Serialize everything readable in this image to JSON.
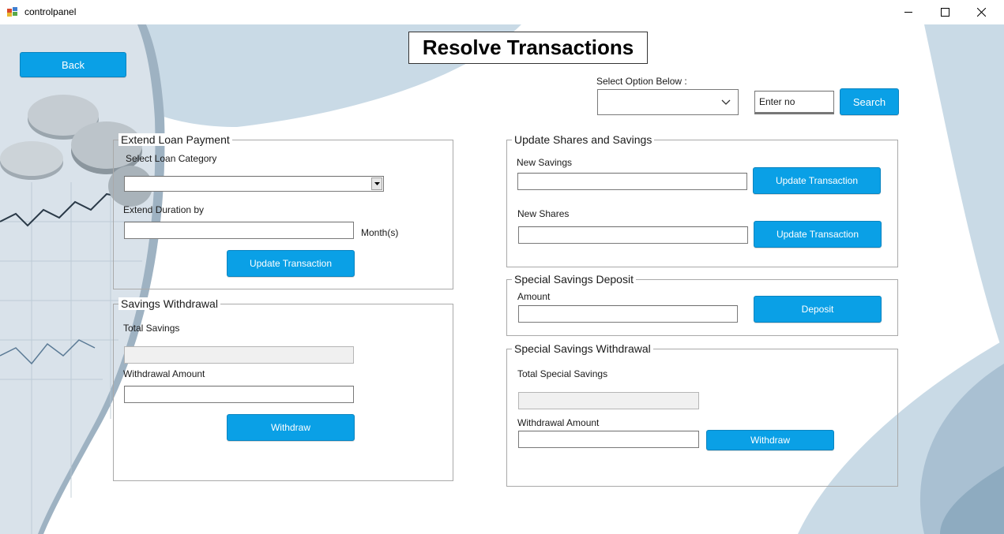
{
  "window": {
    "title": "controlpanel",
    "minimize_icon": "minimize-icon",
    "maximize_icon": "maximize-icon",
    "close_icon": "close-icon"
  },
  "page": {
    "heading": "Resolve Transactions",
    "back_label": "Back"
  },
  "search": {
    "option_label": "Select  Option Below :",
    "option_value": "",
    "input_value": "Enter  no",
    "button_label": "Search"
  },
  "extend_loan": {
    "legend": "Extend Loan Payment",
    "category_label": "Select Loan Category",
    "category_value": "",
    "duration_label": "Extend Duration by",
    "duration_value": "",
    "unit_label": "Month(s)",
    "button_label": "Update Transaction"
  },
  "savings_withdrawal": {
    "legend": "Savings Withdrawal",
    "total_label": "Total Savings",
    "total_value": "",
    "amount_label": "Withdrawal Amount",
    "amount_value": "",
    "button_label": "Withdraw"
  },
  "shares_savings": {
    "legend": "Update Shares and Savings",
    "savings_label": "New Savings",
    "savings_value": "",
    "savings_button": "Update Transaction",
    "shares_label": "New Shares",
    "shares_value": "",
    "shares_button": "Update Transaction"
  },
  "special_deposit": {
    "legend": "Special Savings Deposit",
    "amount_label": "Amount",
    "amount_value": "",
    "button_label": "Deposit"
  },
  "special_withdrawal": {
    "legend": "Special Savings Withdrawal",
    "total_label": "Total Special Savings",
    "total_value": "",
    "amount_label": "Withdrawal Amount",
    "amount_value": "",
    "button_label": "Withdraw"
  },
  "colors": {
    "accent": "#0aa0e6",
    "background_shape": "#c9dae6"
  }
}
